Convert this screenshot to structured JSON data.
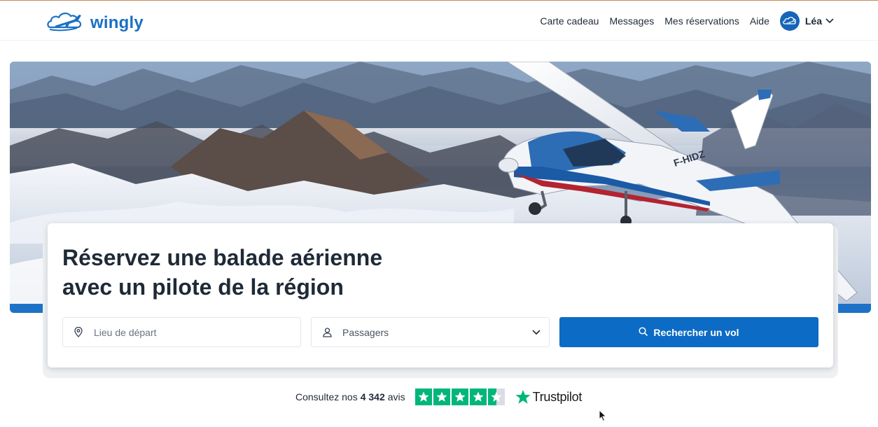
{
  "header": {
    "brand": "wingly",
    "nav": [
      {
        "label": "Carte cadeau"
      },
      {
        "label": "Messages"
      },
      {
        "label": "Mes réservations"
      },
      {
        "label": "Aide"
      }
    ],
    "user": {
      "name": "Léa"
    }
  },
  "hero": {
    "headline_line1": "Réservez une balade aérienne",
    "headline_line2": "avec un pilote de la région",
    "aircraft_registration": "F-HIDZ"
  },
  "search": {
    "departure_placeholder": "Lieu de départ",
    "departure_value": "",
    "passengers_label": "Passagers",
    "button_label": "Rechercher un vol"
  },
  "reviews": {
    "prefix": "Consultez nos",
    "count": "4 342",
    "unit": "avis",
    "rating_stars": 4.5,
    "provider": "Trustpilot"
  },
  "colors": {
    "brand": "#1a70c4",
    "button": "#0c6bc4",
    "trustpilot_green": "#00b67a",
    "text": "#1f2a37"
  },
  "icons": {
    "logo": "plane-cloud-logo",
    "avatar": "plane-cloud-avatar",
    "user_menu": "chevron-down-icon",
    "departure": "location-pin-icon",
    "passengers": "person-icon",
    "passengers_dropdown": "chevron-down-icon",
    "search": "search-icon",
    "review_star": "star-icon",
    "trustpilot": "trustpilot-star-logo"
  }
}
